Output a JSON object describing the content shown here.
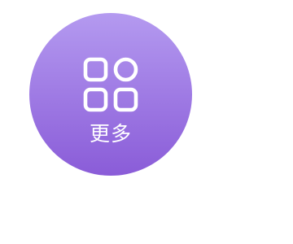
{
  "more_button": {
    "label": "更多",
    "icon": "apps-grid-icon",
    "gradient_top": "#b49af0",
    "gradient_bottom": "#8a5cd8",
    "icon_color": "#ffffff"
  }
}
